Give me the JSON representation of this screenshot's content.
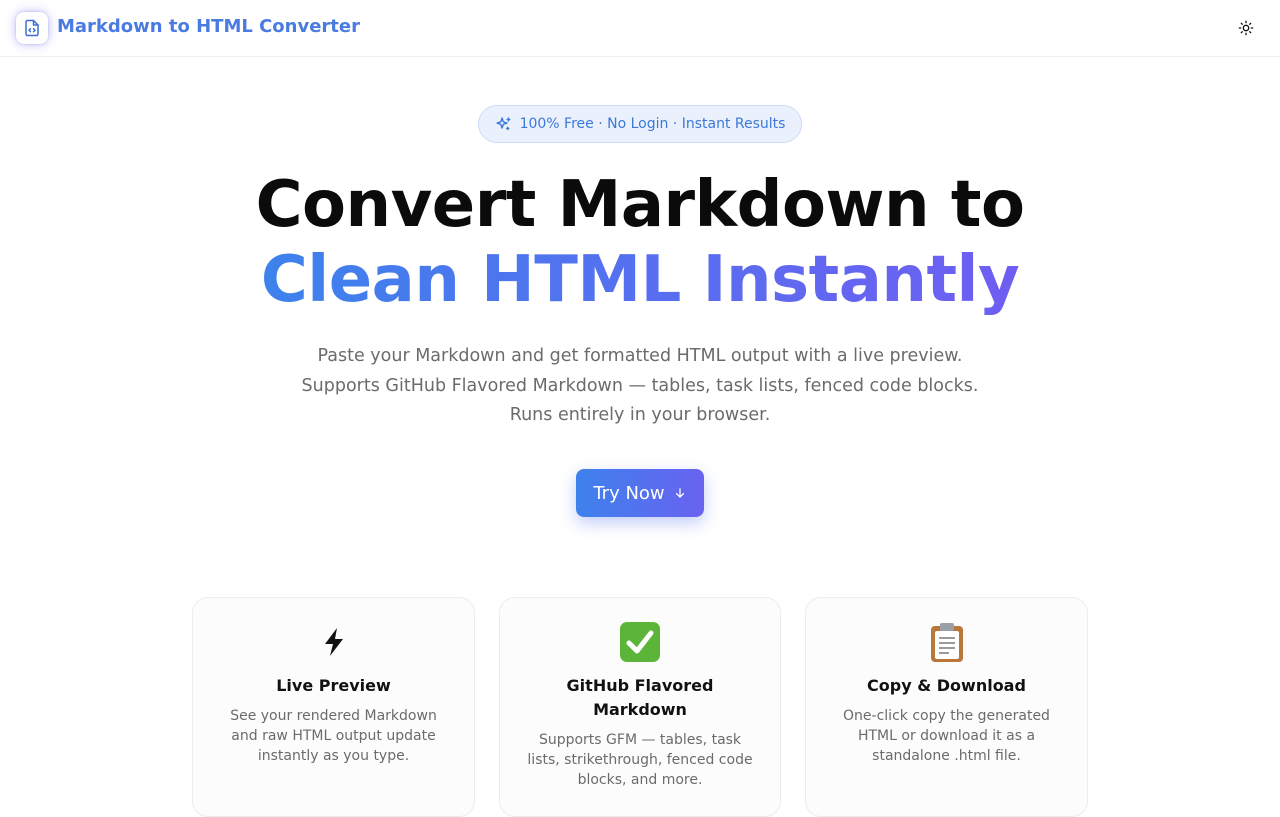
{
  "header": {
    "brand": "Markdown to HTML Converter",
    "logo_icon": "file-code-icon",
    "theme_toggle_icon": "sun-icon"
  },
  "hero": {
    "badge": {
      "icon": "sparkles-icon",
      "text": "100% Free · No Login · Instant Results"
    },
    "title_line1": "Convert Markdown to",
    "title_line2": "Clean HTML Instantly",
    "subtitle": "Paste your Markdown and get formatted HTML output with a live preview. Supports GitHub Flavored Markdown — tables, task lists, fenced code blocks. Runs entirely in your browser.",
    "cta": {
      "label": "Try Now",
      "icon": "arrow-down-icon"
    }
  },
  "features": [
    {
      "icon": "⚡",
      "icon_name": "lightning-icon",
      "title": "Live Preview",
      "description": "See your rendered Markdown and raw HTML output update instantly as you type."
    },
    {
      "icon": "✅",
      "icon_name": "check-mark-icon",
      "title": "GitHub Flavored Markdown",
      "description": "Supports GFM — tables, task lists, strikethrough, fenced code blocks, and more."
    },
    {
      "icon": "📋",
      "icon_name": "clipboard-icon",
      "title": "Copy & Download",
      "description": "One-click copy the generated HTML or download it as a standalone .html file."
    }
  ],
  "colors": {
    "brand": "#4a7be0",
    "gradient_start": "#3d82ec",
    "gradient_end": "#6f5ef2",
    "badge_bg": "#eaf1fd",
    "muted_text": "#6b6b6b"
  }
}
